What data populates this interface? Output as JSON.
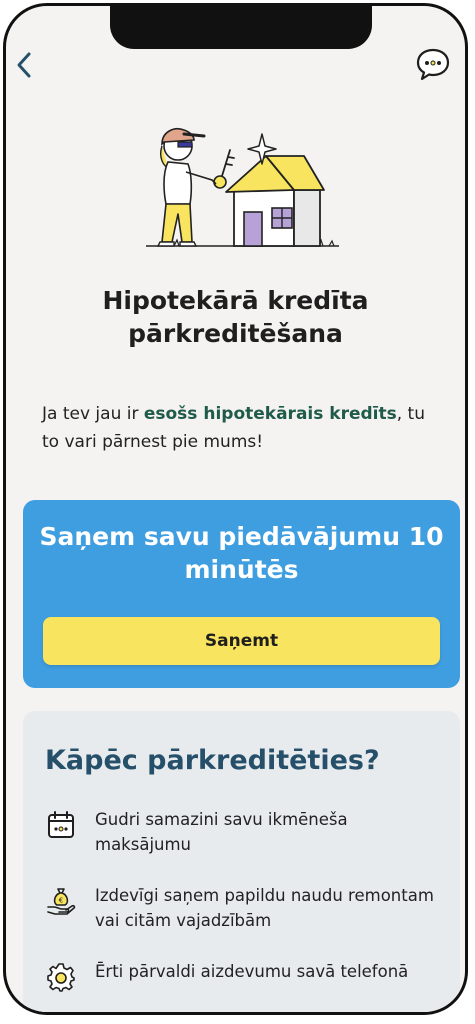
{
  "header": {
    "back_icon": "chevron-left-icon",
    "chat_icon": "chat-bubble-icon"
  },
  "hero": {
    "illustration": "person-with-key-and-house-illustration",
    "title": "Hipotekārā kredīta pārkreditēšana"
  },
  "intro": {
    "prefix": "Ja tev jau ir ",
    "link": "esošs hipotekārais kredīts",
    "suffix": ", tu to vari pārnest pie mums!"
  },
  "offer": {
    "title": "Saņem savu piedāvājumu 10 minūtēs",
    "button": "Saņemt",
    "bg_color": "#3f9ee0",
    "button_color": "#f8e45e"
  },
  "why": {
    "title": "Kāpēc pārkreditēties?",
    "benefits": [
      {
        "icon": "calendar-icon",
        "text": "Gudri samazini savu ikmēneša maksājumu"
      },
      {
        "icon": "money-bag-hand-icon",
        "text": "Izdevīgi saņem papildu naudu remontam vai citām vajadzībām"
      },
      {
        "icon": "gear-icon",
        "text": "Ērti pārvaldi aizdevumu savā telefonā"
      }
    ]
  }
}
